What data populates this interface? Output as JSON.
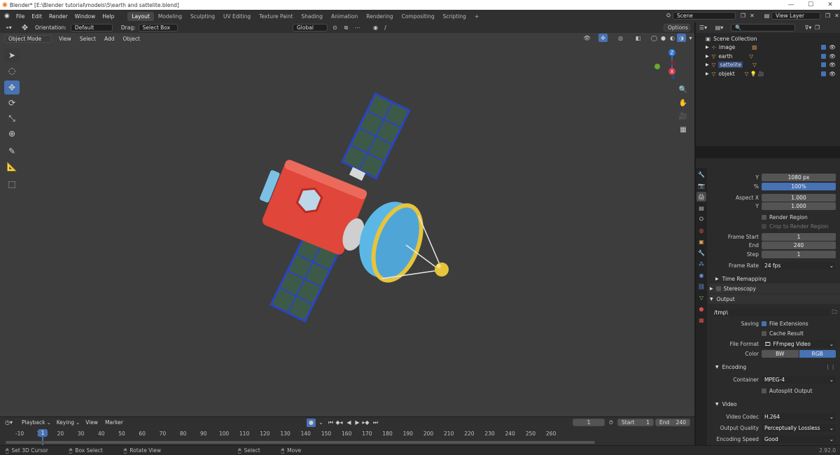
{
  "titlebar": {
    "title": "Blender* [E:\\Blender tutorial\\models\\5\\earth and sattelite.blend]"
  },
  "menu": [
    "File",
    "Edit",
    "Render",
    "Window",
    "Help"
  ],
  "workspaces": [
    "Layout",
    "Modeling",
    "Sculpting",
    "UV Editing",
    "Texture Paint",
    "Shading",
    "Animation",
    "Rendering",
    "Compositing",
    "Scripting"
  ],
  "add_workspace": "+",
  "scene": {
    "label": "Scene",
    "view_layer": "View Layer"
  },
  "tool_header": {
    "orientation_label": "Orientation:",
    "orientation_value": "Default",
    "drag_label": "Drag:",
    "drag_value": "Select Box",
    "transform_value": "Global",
    "options": "Options"
  },
  "viewport_header": {
    "mode": "Object Mode",
    "menus": [
      "View",
      "Select",
      "Add",
      "Object"
    ]
  },
  "outliner": {
    "root": "Scene Collection",
    "items": [
      "image",
      "earth",
      "sattelite",
      "objekt"
    ]
  },
  "properties": {
    "res_y_label": "Y",
    "res_y_value": "1080 px",
    "percent_label": "%",
    "percent_value": "100%",
    "aspect_x_label": "Aspect X",
    "aspect_x_value": "1.000",
    "aspect_y_label": "Y",
    "aspect_y_value": "1.000",
    "render_region": "Render Region",
    "crop_region": "Crop to Render Region",
    "frame_start_label": "Frame Start",
    "frame_start_value": "1",
    "end_label": "End",
    "end_value": "240",
    "step_label": "Step",
    "step_value": "1",
    "frame_rate_label": "Frame Rate",
    "frame_rate_value": "24 fps",
    "time_remapping": "Time Remapping",
    "stereoscopy": "Stereoscopy",
    "output": "Output",
    "output_path": "/tmp\\",
    "saving_label": "Saving",
    "file_extensions": "File Extensions",
    "cache_result": "Cache Result",
    "file_format_label": "File Format",
    "file_format_value": "FFmpeg Video",
    "color_label": "Color",
    "color_bw": "BW",
    "color_rgb": "RGB",
    "encoding": "Encoding",
    "container_label": "Container",
    "container_value": "MPEG-4",
    "autosplit": "Autosplit Output",
    "video": "Video",
    "video_codec_label": "Video Codec",
    "video_codec_value": "H.264",
    "output_quality_label": "Output Quality",
    "output_quality_value": "Perceptually Lossless",
    "encoding_speed_label": "Encoding Speed",
    "encoding_speed_value": "Good"
  },
  "timeline": {
    "menus": [
      "Playback",
      "Keying",
      "View",
      "Marker"
    ],
    "current_frame": "1",
    "start_label": "Start",
    "start_value": "1",
    "end_label": "End",
    "end_value": "240",
    "ticks": [
      "-10",
      "10",
      "20",
      "30",
      "40",
      "50",
      "60",
      "70",
      "80",
      "90",
      "100",
      "110",
      "120",
      "130",
      "140",
      "150",
      "160",
      "170",
      "180",
      "190",
      "200",
      "210",
      "220",
      "230",
      "240",
      "250",
      "260"
    ],
    "current_tick": "1"
  },
  "statusbar": {
    "items": [
      "Set 3D Cursor",
      "Box Select",
      "Rotate View",
      "Select",
      "Move"
    ],
    "version": "2.92.0"
  },
  "gizmo": {
    "x": "X",
    "y": "Y",
    "z": "Z"
  },
  "colors": {
    "accent": "#4772b3",
    "viewport_bg": "#3d3d3d",
    "panel": "#303030",
    "satellite_body": "#e0463a",
    "solar_panel": "#3d5a48",
    "dish": "#5bb8e6",
    "dish_ring": "#e6c43c"
  }
}
